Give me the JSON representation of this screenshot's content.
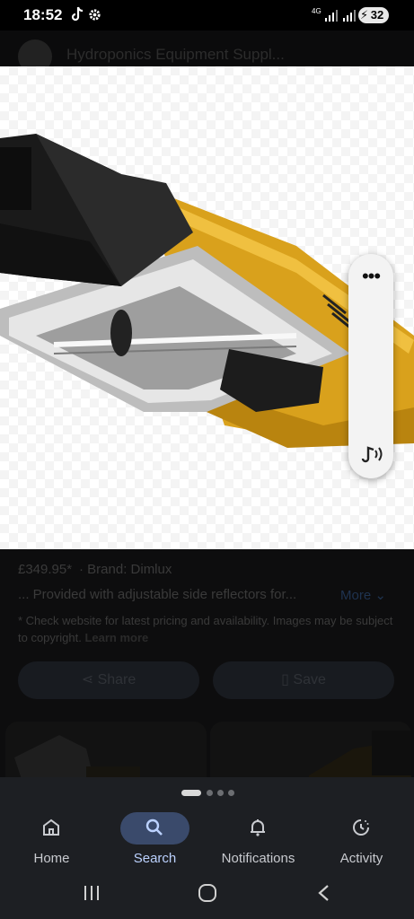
{
  "status_bar": {
    "time": "18:52",
    "network": "4G",
    "battery": "32"
  },
  "header": {
    "site_title": "Hydroponics Equipment Suppl..."
  },
  "product": {
    "price": "£349.95*",
    "brand": "· Brand: Dimlux",
    "description": "... Provided with adjustable side reflectors for...",
    "more_label": "More",
    "disclaimer": "* Check website for latest pricing and availability. Images may be subject to copyright.",
    "learn_more": "Learn more"
  },
  "actions": {
    "share_label": "Share",
    "save_label": "Save"
  },
  "floating_menu": {
    "more_glyph": "•••"
  },
  "nav": {
    "items": [
      {
        "label": "Home",
        "icon": "home-icon"
      },
      {
        "label": "Search",
        "icon": "search-icon"
      },
      {
        "label": "Notifications",
        "icon": "bell-icon"
      },
      {
        "label": "Activity",
        "icon": "activity-icon"
      }
    ],
    "active": "Search"
  },
  "colors": {
    "accent": "#bcd2ff",
    "nav_bg": "#1d1f23",
    "highlight": "#3a4a6b"
  }
}
